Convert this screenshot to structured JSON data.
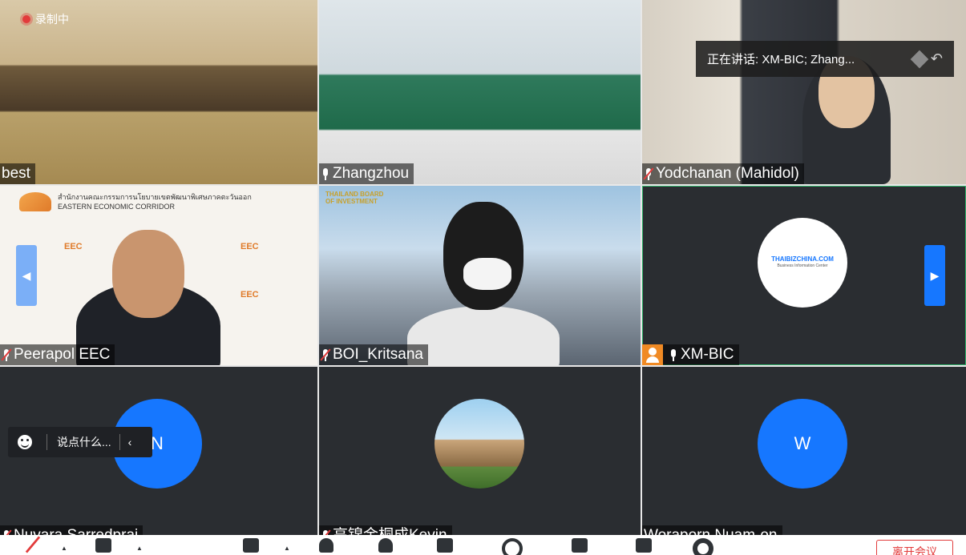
{
  "recording": {
    "label": "录制中"
  },
  "speaking": {
    "text": "正在讲话: XM-BIC; Zhang..."
  },
  "tiles": [
    {
      "name": "best",
      "muted": false
    },
    {
      "name": "Zhangzhou",
      "muted": false
    },
    {
      "name": "Yodchanan (Mahidol)",
      "muted": true
    },
    {
      "name": "Peerapol EEC",
      "muted": true
    },
    {
      "name": "BOI_Kritsana",
      "muted": true
    },
    {
      "name": "XM-BIC",
      "muted": false,
      "host": true,
      "logo": {
        "main": "THAIBIZCHINA.COM",
        "sub": "Business Information Center"
      }
    },
    {
      "name": "Nuvara Sarredpraj",
      "muted": true,
      "initial": "N"
    },
    {
      "name": "高锦金桐成Kevin",
      "muted": true
    },
    {
      "name": "Woraporn Nuam-on",
      "muted": true,
      "initial": "W"
    }
  ],
  "eec": {
    "thai": "สำนักงานคณะกรรมการนโยบายเขตพัฒนาพิเศษภาคตะวันออก",
    "en": "EASTERN ECONOMIC CORRIDOR",
    "mark": "EEC"
  },
  "boi": {
    "logo": "THAILAND BOARD OF INVESTMENT"
  },
  "chat": {
    "placeholder": "说点什么..."
  },
  "toolbar": {
    "end_label": "离开会议"
  },
  "colors": {
    "accent": "#1677ff",
    "danger": "#e23b3b",
    "active_border": "#2fb36a"
  }
}
